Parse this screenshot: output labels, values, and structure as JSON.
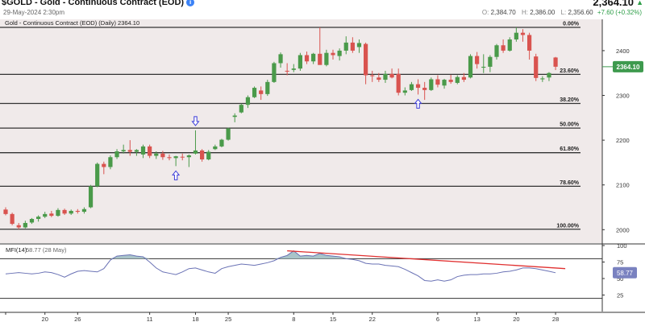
{
  "header": {
    "title": "$GOLD - Gold - Continuous Contract (EOD)",
    "date": "29-May-2024 2:30pm",
    "last": "2,364.10",
    "open_label": "O:",
    "open": "2,384.70",
    "high_label": "H:",
    "high": "2,386.00",
    "low_label": "L:",
    "low": "2,356.60",
    "change": "+7.60 (+0.32%)"
  },
  "panel": {
    "legend": "Gold - Continuous Contract (EOD) (Daily) 2364.10",
    "price_tag": "2364.10",
    "mfi_legend_label": "MFI(14)",
    "mfi_legend_value": "58.77 (28 May)",
    "mfi_tag": "58.77"
  },
  "colors": {
    "up": "#4a9a4a",
    "down": "#d9534f",
    "fib_line": "#333333",
    "mfi_line": "#6a72b5",
    "mfi_fill": "#a9c4c9",
    "trend": "#e03030",
    "arrow": "#3b3bd9",
    "price_tag_bg": "#3e9a4e",
    "mfi_tag_bg": "#7a82c0",
    "plot_bg": "#f0eaea"
  },
  "chart_data": [
    {
      "type": "candlestick",
      "title": "Gold - Continuous Contract (EOD) (Daily) 2364.10",
      "y_axis_ticks": [
        2000,
        2100,
        2200,
        2300,
        2400
      ],
      "ylim": [
        1970,
        2470
      ],
      "x_tick_labels": [
        "",
        "20",
        "26",
        "11",
        "18",
        "25",
        "8",
        "15",
        "22",
        "6",
        "13",
        "20",
        "28"
      ],
      "candles": [
        {
          "o": 2045,
          "h": 2050,
          "l": 2032,
          "c": 2035
        },
        {
          "o": 2035,
          "h": 2038,
          "l": 2010,
          "c": 2013
        },
        {
          "o": 2010,
          "h": 2015,
          "l": 2001,
          "c": 2005
        },
        {
          "o": 2005,
          "h": 2020,
          "l": 2003,
          "c": 2015
        },
        {
          "o": 2016,
          "h": 2026,
          "l": 2013,
          "c": 2024
        },
        {
          "o": 2024,
          "h": 2032,
          "l": 2018,
          "c": 2029
        },
        {
          "o": 2029,
          "h": 2040,
          "l": 2026,
          "c": 2035
        },
        {
          "o": 2036,
          "h": 2042,
          "l": 2028,
          "c": 2031
        },
        {
          "o": 2031,
          "h": 2048,
          "l": 2029,
          "c": 2044
        },
        {
          "o": 2044,
          "h": 2047,
          "l": 2033,
          "c": 2036
        },
        {
          "o": 2036,
          "h": 2045,
          "l": 2033,
          "c": 2042
        },
        {
          "o": 2042,
          "h": 2046,
          "l": 2036,
          "c": 2040
        },
        {
          "o": 2040,
          "h": 2050,
          "l": 2036,
          "c": 2046
        },
        {
          "o": 2050,
          "h": 2100,
          "l": 2048,
          "c": 2097
        },
        {
          "o": 2097,
          "h": 2150,
          "l": 2095,
          "c": 2147
        },
        {
          "o": 2147,
          "h": 2152,
          "l": 2124,
          "c": 2140
        },
        {
          "o": 2140,
          "h": 2166,
          "l": 2135,
          "c": 2162
        },
        {
          "o": 2162,
          "h": 2180,
          "l": 2158,
          "c": 2175
        },
        {
          "o": 2175,
          "h": 2190,
          "l": 2170,
          "c": 2178
        },
        {
          "o": 2178,
          "h": 2200,
          "l": 2165,
          "c": 2174
        },
        {
          "o": 2174,
          "h": 2180,
          "l": 2165,
          "c": 2178
        },
        {
          "o": 2168,
          "h": 2190,
          "l": 2160,
          "c": 2186
        },
        {
          "o": 2186,
          "h": 2190,
          "l": 2160,
          "c": 2165
        },
        {
          "o": 2165,
          "h": 2175,
          "l": 2158,
          "c": 2170
        },
        {
          "o": 2170,
          "h": 2176,
          "l": 2156,
          "c": 2162
        },
        {
          "o": 2162,
          "h": 2168,
          "l": 2155,
          "c": 2160
        },
        {
          "o": 2160,
          "h": 2165,
          "l": 2142,
          "c": 2164
        },
        {
          "o": 2163,
          "h": 2170,
          "l": 2155,
          "c": 2162
        },
        {
          "o": 2162,
          "h": 2168,
          "l": 2140,
          "c": 2166
        },
        {
          "o": 2170,
          "h": 2222,
          "l": 2168,
          "c": 2177
        },
        {
          "o": 2177,
          "h": 2180,
          "l": 2152,
          "c": 2157
        },
        {
          "o": 2157,
          "h": 2178,
          "l": 2155,
          "c": 2174
        },
        {
          "o": 2180,
          "h": 2190,
          "l": 2178,
          "c": 2186
        },
        {
          "o": 2186,
          "h": 2203,
          "l": 2184,
          "c": 2201
        },
        {
          "o": 2201,
          "h": 2228,
          "l": 2199,
          "c": 2226
        },
        {
          "o": 2252,
          "h": 2260,
          "l": 2240,
          "c": 2255
        },
        {
          "o": 2262,
          "h": 2282,
          "l": 2260,
          "c": 2279
        },
        {
          "o": 2279,
          "h": 2300,
          "l": 2272,
          "c": 2296
        },
        {
          "o": 2296,
          "h": 2320,
          "l": 2294,
          "c": 2317
        },
        {
          "o": 2311,
          "h": 2320,
          "l": 2290,
          "c": 2303
        },
        {
          "o": 2303,
          "h": 2335,
          "l": 2299,
          "c": 2330
        },
        {
          "o": 2330,
          "h": 2375,
          "l": 2328,
          "c": 2372
        },
        {
          "o": 2372,
          "h": 2396,
          "l": 2362,
          "c": 2392
        },
        {
          "o": 2355,
          "h": 2372,
          "l": 2345,
          "c": 2354
        },
        {
          "o": 2357,
          "h": 2370,
          "l": 2352,
          "c": 2360
        },
        {
          "o": 2360,
          "h": 2395,
          "l": 2355,
          "c": 2390
        },
        {
          "o": 2390,
          "h": 2398,
          "l": 2370,
          "c": 2376
        },
        {
          "o": 2376,
          "h": 2395,
          "l": 2370,
          "c": 2393
        },
        {
          "o": 2393,
          "h": 2452,
          "l": 2385,
          "c": 2368
        },
        {
          "o": 2368,
          "h": 2402,
          "l": 2365,
          "c": 2395
        },
        {
          "o": 2395,
          "h": 2402,
          "l": 2380,
          "c": 2390
        },
        {
          "o": 2388,
          "h": 2405,
          "l": 2378,
          "c": 2400
        },
        {
          "o": 2400,
          "h": 2432,
          "l": 2392,
          "c": 2418
        },
        {
          "o": 2418,
          "h": 2430,
          "l": 2395,
          "c": 2400
        },
        {
          "o": 2408,
          "h": 2425,
          "l": 2395,
          "c": 2417
        },
        {
          "o": 2415,
          "h": 2418,
          "l": 2325,
          "c": 2345
        },
        {
          "o": 2345,
          "h": 2355,
          "l": 2330,
          "c": 2343
        },
        {
          "o": 2340,
          "h": 2350,
          "l": 2330,
          "c": 2335
        },
        {
          "o": 2335,
          "h": 2355,
          "l": 2328,
          "c": 2348
        },
        {
          "o": 2348,
          "h": 2360,
          "l": 2338,
          "c": 2340
        },
        {
          "o": 2348,
          "h": 2360,
          "l": 2300,
          "c": 2306
        },
        {
          "o": 2306,
          "h": 2318,
          "l": 2300,
          "c": 2311
        },
        {
          "o": 2312,
          "h": 2330,
          "l": 2310,
          "c": 2325
        },
        {
          "o": 2325,
          "h": 2336,
          "l": 2302,
          "c": 2317
        },
        {
          "o": 2317,
          "h": 2330,
          "l": 2290,
          "c": 2312
        },
        {
          "o": 2312,
          "h": 2340,
          "l": 2310,
          "c": 2336
        },
        {
          "o": 2336,
          "h": 2345,
          "l": 2318,
          "c": 2324
        },
        {
          "o": 2322,
          "h": 2337,
          "l": 2315,
          "c": 2335
        },
        {
          "o": 2335,
          "h": 2346,
          "l": 2326,
          "c": 2330
        },
        {
          "o": 2328,
          "h": 2345,
          "l": 2325,
          "c": 2341
        },
        {
          "o": 2341,
          "h": 2350,
          "l": 2330,
          "c": 2335
        },
        {
          "o": 2340,
          "h": 2392,
          "l": 2338,
          "c": 2388
        },
        {
          "o": 2388,
          "h": 2397,
          "l": 2360,
          "c": 2370
        },
        {
          "o": 2362,
          "h": 2392,
          "l": 2350,
          "c": 2364
        },
        {
          "o": 2364,
          "h": 2390,
          "l": 2352,
          "c": 2386
        },
        {
          "o": 2386,
          "h": 2415,
          "l": 2380,
          "c": 2412
        },
        {
          "o": 2412,
          "h": 2425,
          "l": 2395,
          "c": 2400
        },
        {
          "o": 2400,
          "h": 2430,
          "l": 2398,
          "c": 2425
        },
        {
          "o": 2425,
          "h": 2452,
          "l": 2420,
          "c": 2440
        },
        {
          "o": 2440,
          "h": 2448,
          "l": 2420,
          "c": 2435
        },
        {
          "o": 2435,
          "h": 2440,
          "l": 2380,
          "c": 2400
        },
        {
          "o": 2387,
          "h": 2393,
          "l": 2332,
          "c": 2339
        },
        {
          "o": 2336,
          "h": 2343,
          "l": 2330,
          "c": 2338
        },
        {
          "o": 2340,
          "h": 2352,
          "l": 2332,
          "c": 2350
        },
        {
          "o": 2384.7,
          "h": 2386,
          "l": 2356.6,
          "c": 2364.1
        }
      ],
      "fib_levels": [
        {
          "label": "0.00%",
          "value": 2452
        },
        {
          "label": "23.60%",
          "value": 2347
        },
        {
          "label": "38.20%",
          "value": 2282
        },
        {
          "label": "50.00%",
          "value": 2227
        },
        {
          "label": "61.80%",
          "value": 2172
        },
        {
          "label": "78.60%",
          "value": 2097
        },
        {
          "label": "100.00%",
          "value": 2001
        }
      ],
      "annotations": [
        {
          "type": "arrow-down",
          "candle": 29
        },
        {
          "type": "arrow-up",
          "candle": 26
        },
        {
          "type": "arrow-up",
          "candle": 63
        }
      ],
      "last_price": 2364.1
    },
    {
      "type": "line",
      "title": "MFI(14) 58.77 (28 May)",
      "y_axis_ticks": [
        25,
        50,
        75,
        100
      ],
      "ylim": [
        0,
        100
      ],
      "overbought": 80,
      "oversold": 20,
      "series": [
        {
          "name": "MFI(14)",
          "values": [
            57,
            58,
            59,
            58,
            57,
            58,
            60,
            59,
            56,
            52,
            57,
            61,
            62,
            61,
            60,
            65,
            78,
            84,
            85,
            86,
            84,
            83,
            75,
            66,
            60,
            58,
            56,
            60,
            65,
            66,
            63,
            60,
            58,
            65,
            68,
            70,
            72,
            71,
            70,
            72,
            74,
            77,
            82,
            85,
            92,
            84,
            85,
            84,
            88,
            85,
            84,
            83,
            80,
            79,
            77,
            73,
            72,
            72,
            70,
            69,
            68,
            64,
            59,
            54,
            47,
            46,
            48,
            46,
            48,
            53,
            55,
            56,
            56,
            57,
            57,
            58,
            60,
            61,
            63,
            66,
            66,
            65,
            63,
            61,
            58.77
          ]
        }
      ],
      "trend_line": {
        "from": {
          "candle": 43,
          "value": 92
        },
        "to": {
          "candle": 84,
          "value": 65
        }
      },
      "last_value": 58.77
    }
  ]
}
